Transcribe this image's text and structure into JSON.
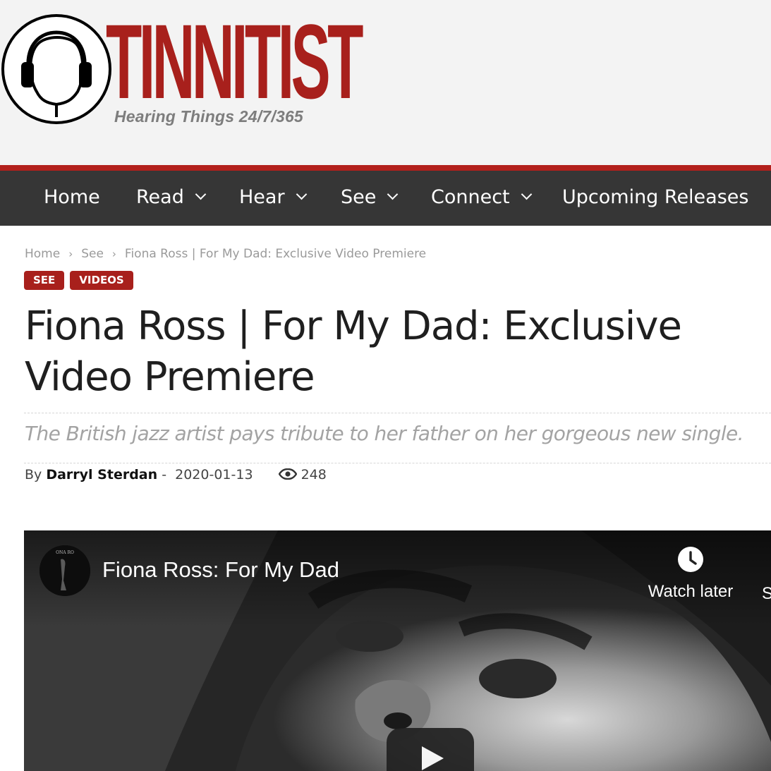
{
  "site": {
    "logo_word": "TINNITIST",
    "logo_tagline": "Hearing Things 24/7/365",
    "brand_color": "#a8201c"
  },
  "nav": {
    "items": [
      {
        "label": "Home",
        "dropdown": false
      },
      {
        "label": "Read",
        "dropdown": true
      },
      {
        "label": "Hear",
        "dropdown": true
      },
      {
        "label": "See",
        "dropdown": true
      },
      {
        "label": "Connect",
        "dropdown": true
      },
      {
        "label": "Upcoming Releases",
        "dropdown": false
      }
    ]
  },
  "breadcrumb": {
    "items": [
      "Home",
      "See",
      "Fiona Ross | For My Dad: Exclusive Video Premiere"
    ],
    "separator": "›"
  },
  "tags": [
    "SEE",
    "VIDEOS"
  ],
  "article": {
    "title": "Fiona Ross | For My Dad: Exclusive Video Premiere",
    "subtitle": "The British jazz artist pays tribute to her father on her gorgeous new single.",
    "by_prefix": "By",
    "author": "Darryl Sterdan",
    "date_sep": "-",
    "date": "2020-01-13",
    "views": "248",
    "views_icon": "eye-icon"
  },
  "video": {
    "title": "Fiona Ross: For My Dad",
    "channel_avatar_text": "ONA RO",
    "watch_later_label": "Watch later",
    "share_label_cut": "S",
    "play_icon": "play-icon"
  }
}
